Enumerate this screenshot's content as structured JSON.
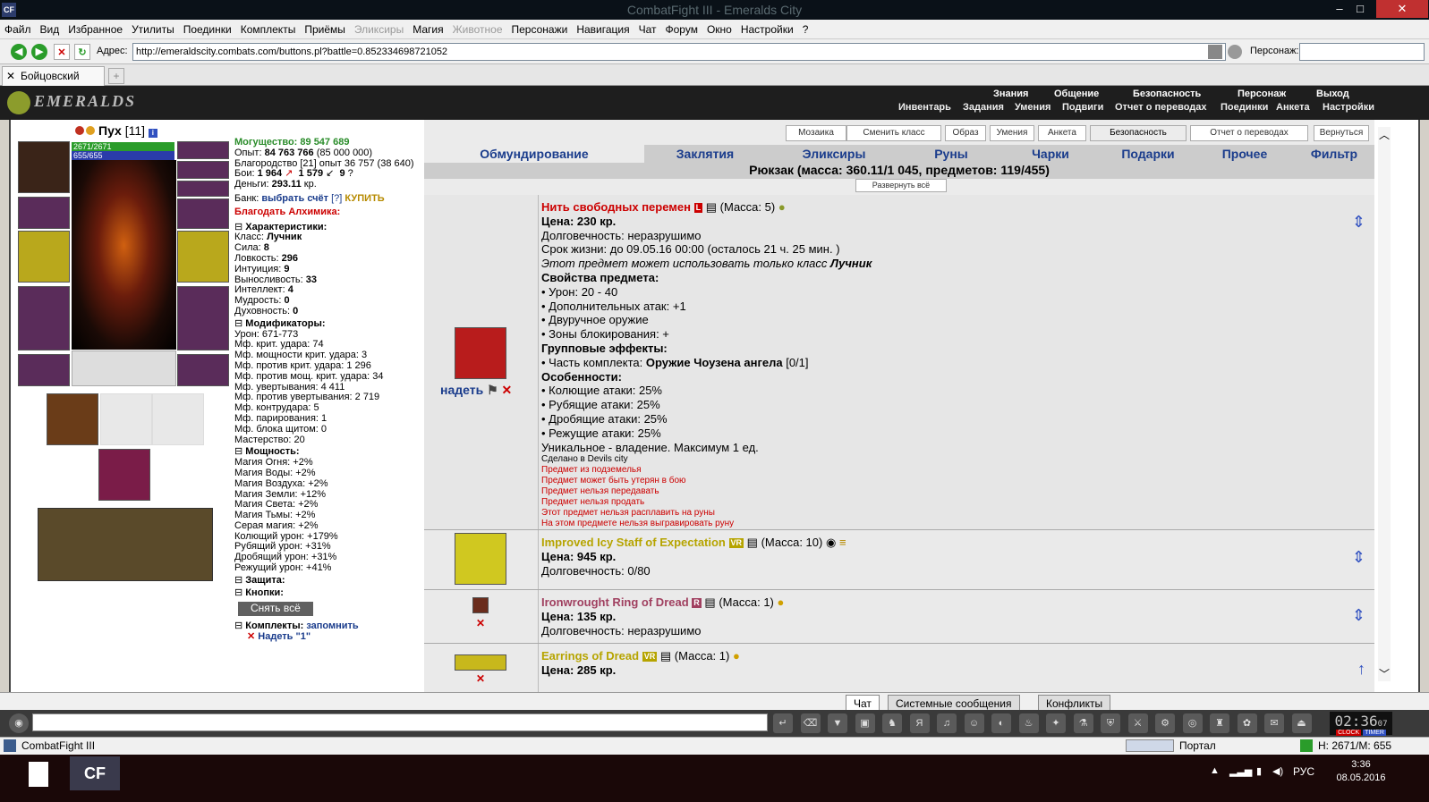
{
  "window": {
    "title": "CombatFight III - Emeralds City",
    "app_icon": "CF"
  },
  "menu": [
    {
      "label": "Файл"
    },
    {
      "label": "Вид"
    },
    {
      "label": "Избранное"
    },
    {
      "label": "Утилиты"
    },
    {
      "label": "Поединки"
    },
    {
      "label": "Комплекты"
    },
    {
      "label": "Приёмы"
    },
    {
      "label": "Эликсиры",
      "dim": true
    },
    {
      "label": "Магия"
    },
    {
      "label": "Животное",
      "dim": true
    },
    {
      "label": "Персонажи"
    },
    {
      "label": "Навигация"
    },
    {
      "label": "Чат"
    },
    {
      "label": "Форум"
    },
    {
      "label": "Окно"
    },
    {
      "label": "Настройки"
    },
    {
      "label": "?"
    }
  ],
  "address": {
    "label": "Адрес:",
    "url": "http://emeraldscity.combats.com/buttons.pl?battle=0.852334698721052",
    "char_label": "Персонаж:"
  },
  "browser_tab": {
    "label": "Бойцовский клуб"
  },
  "game_nav": {
    "logo": "EMERALDS",
    "top": [
      "Знания",
      "Общение",
      "Безопасность",
      "Персонаж",
      "Выход"
    ],
    "bottom": [
      "Инвентарь",
      "Задания",
      "Умения",
      "Подвиги",
      "Отчет о переводах",
      "Поединки",
      "Анкета",
      "Настройки"
    ]
  },
  "character": {
    "name": "Пух",
    "level": "[11]",
    "hp": "2671/2671",
    "mp": "655/655"
  },
  "stats": {
    "power": "Могущество: 89 547 689",
    "exp_label": "Опыт:",
    "exp_value": "84 763 766",
    "exp_next": "(85 000 000)",
    "nobility": "Благородство [21] опыт 36 757 (38 640)",
    "battles_label": "Бои:",
    "wins": "1 964",
    "losses": "1 579",
    "draws": "9",
    "money_label": "Деньги:",
    "money_value": "293.11",
    "money_unit": "кр.",
    "bank_label": "Банк:",
    "bank_link": "выбрать счёт",
    "bank_help": "[?]",
    "bank_buy": "КУПИТЬ",
    "alchemist": "Благодать Алхимика:"
  },
  "characteristics": {
    "title": "Характеристики:",
    "rows": [
      {
        "k": "Класс:",
        "v": "Лучник"
      },
      {
        "k": "Сила:",
        "v": "8"
      },
      {
        "k": "Ловкость:",
        "v": "296"
      },
      {
        "k": "Интуиция:",
        "v": "9"
      },
      {
        "k": "Выносливость:",
        "v": "33"
      },
      {
        "k": "Интеллект:",
        "v": "4"
      },
      {
        "k": "Мудрость:",
        "v": "0"
      },
      {
        "k": "Духовность:",
        "v": "0"
      }
    ]
  },
  "modifiers": {
    "title": "Модификаторы:",
    "rows": [
      "Урон: 671-773",
      "Мф. крит. удара: 74",
      "Мф. мощности крит. удара: 3",
      "Мф. против крит. удара: 1 296",
      "Мф. против мощ. крит. удара: 34",
      "Мф. увертывания: 4 411",
      "Мф. против увертывания: 2 719",
      "Мф. контрудара: 5",
      "Мф. парирования: 1",
      "Мф. блока щитом: 0",
      "Мастерство: 20"
    ]
  },
  "powers": {
    "title": "Мощность:",
    "rows": [
      "Магия Огня: +2%",
      "Магия Воды: +2%",
      "Магия Воздуха: +2%",
      "Магия Земли: +12%",
      "Магия Света: +2%",
      "Магия Тьмы: +2%",
      "Серая магия: +2%",
      "Колющий урон: +179%",
      "Рубящий урон: +31%",
      "Дробящий урон: +31%",
      "Режущий урон: +41%"
    ]
  },
  "protection": {
    "title": "Защита:"
  },
  "buttons": {
    "title": "Кнопки:",
    "unequip": "Снять всё"
  },
  "sets": {
    "title": "Комплекты:",
    "remember": "запомнить",
    "equip": "Надеть \"1\""
  },
  "top_buttons": [
    "Мозаика",
    "Сменить класс",
    "Образ",
    "Умения",
    "Анкета",
    "Безопасность",
    "Отчет о переводах",
    "Вернуться"
  ],
  "categories": [
    "Обмундирование",
    "Заклятия",
    "Эликсиры",
    "Руны",
    "Чарки",
    "Подарки",
    "Прочее",
    "Фильтр"
  ],
  "backpack": {
    "title": "Рюкзак (масса: 360.11/1 045, предметов: 119/455)",
    "expand": "Развернуть всё"
  },
  "items": [
    {
      "name": "Нить свободных перемен",
      "badge": "L",
      "mass": "(Масса: 5)",
      "price": "Цена: 230 кр.",
      "lines": [
        "Долговечность: неразрушимо",
        "Срок жизни: до 09.05.16 00:00 (осталось 21 ч. 25 мин. )"
      ],
      "class_note": "Этот предмет может использовать только класс",
      "class_name": "Лучник",
      "props_title": "Свойства предмета:",
      "props": [
        "• Урон: 20 - 40",
        "• Дополнительных атак: +1",
        "• Двуручное оружие",
        "• Зоны блокирования: +"
      ],
      "group_title": "Групповые эффекты:",
      "group_prefix": "• Часть комплекта:",
      "group_set": "Оружие Чоузена ангела",
      "group_count": "[0/1]",
      "feat_title": "Особенности:",
      "feats": [
        "• Колющие атаки: 25%",
        "• Рубящие атаки: 25%",
        "• Дробящие атаки: 25%",
        "• Режущие атаки: 25%"
      ],
      "unique": "Уникальное - владение. Максимум 1 ед.",
      "made": "Сделано в Devils city",
      "notes": [
        "Предмет из подземелья",
        "Предмет может быть утерян в бою",
        "Предмет нельзя передавать",
        "Предмет нельзя продать",
        "Этот предмет нельзя расплавить на руны",
        "На этом предмете нельзя выгравировать руну"
      ],
      "equip": "надеть"
    },
    {
      "name": "Improved Icy Staff of Expectation",
      "badge": "VR",
      "mass": "(Масса: 10)",
      "price": "Цена: 945 кр.",
      "lines": [
        "Долговечность: 0/80"
      ]
    },
    {
      "name": "Ironwrought Ring of Dread",
      "badge": "R",
      "mass": "(Масса: 1)",
      "price": "Цена: 135 кр.",
      "lines": [
        "Долговечность: неразрушимо"
      ]
    },
    {
      "name": "Earrings of Dread",
      "badge": "VR",
      "mass": "(Масса: 1)",
      "price": "Цена: 285 кр."
    }
  ],
  "chat_tabs": [
    "Чат",
    "Системные сообщения",
    "Конфликты"
  ],
  "clock": {
    "time": "02:36",
    "sec": "07",
    "clock": "CLOCK",
    "timer": "TIMER"
  },
  "status": {
    "left": "CombatFight III",
    "portal": "Портал",
    "hp": "H: 2671/M: 655"
  },
  "taskbar": {
    "app": "CF",
    "lang": "РУС",
    "time": "3:36",
    "date": "08.05.2016"
  },
  "colors": {
    "accent": "#1a3c8c",
    "item_red": "#cc0000",
    "item_gold": "#b6a400",
    "item_pink": "#a04060",
    "hp": "#2a9c2a",
    "mp": "#2a3caa"
  }
}
